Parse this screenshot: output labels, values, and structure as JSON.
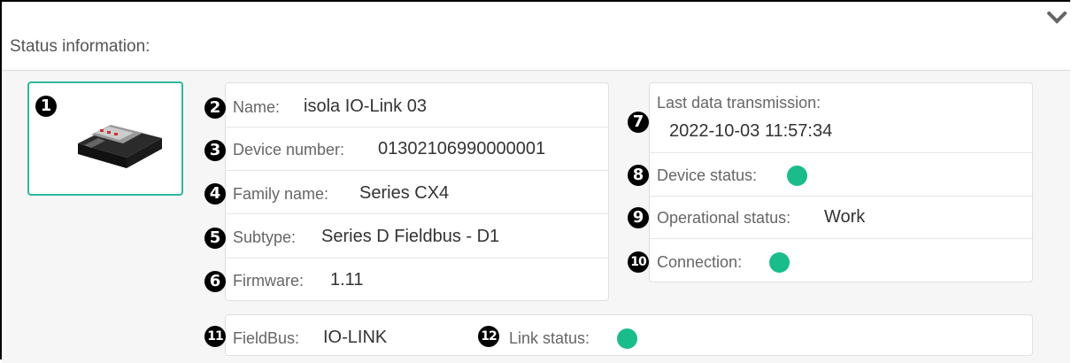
{
  "header": {
    "title": "Status information:",
    "collapse_icon": "chevron-down-icon"
  },
  "badges": [
    "1",
    "2",
    "3",
    "4",
    "5",
    "6",
    "7",
    "8",
    "9",
    "10",
    "11",
    "12"
  ],
  "device_info": {
    "name_label": "Name:",
    "name_value": "isola IO-Link 03",
    "device_number_label": "Device number:",
    "device_number_value": "01302106990000001",
    "family_label": "Family name:",
    "family_value": "Series CX4",
    "subtype_label": "Subtype:",
    "subtype_value": "Series D Fieldbus - D1",
    "firmware_label": "Firmware:",
    "firmware_value": "1.11"
  },
  "status": {
    "last_tx_label": "Last data transmission:",
    "last_tx_value": "2022-10-03 11:57:34",
    "device_status_label": "Device status:",
    "operational_label": "Operational status:",
    "operational_value": "Work",
    "connection_label": "Connection:"
  },
  "fieldbus": {
    "label": "FieldBus:",
    "value": "IO-LINK",
    "link_status_label": "Link status:"
  },
  "colors": {
    "status_ok": "#1abc8c",
    "accent_border": "#2fb79a"
  }
}
